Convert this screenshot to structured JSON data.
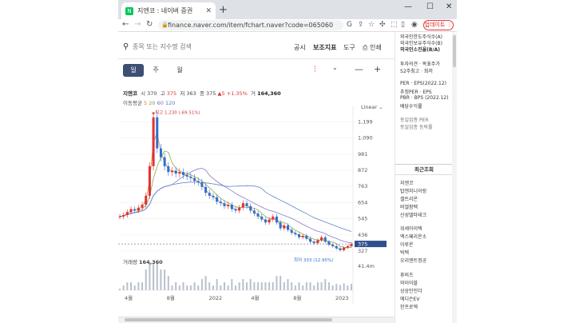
{
  "browser": {
    "tab_title": "지엔코 : 네이버 증권",
    "favicon_letter": "N",
    "url": "finance.naver.com/item/fchart.naver?code=065060",
    "update_label": "업데이트"
  },
  "header": {
    "search_placeholder": "종목 또는 지수명 검색",
    "links": [
      "공시",
      "보조지표",
      "도구",
      "인쇄"
    ]
  },
  "periods": [
    "일",
    "주",
    "월"
  ],
  "active_period": 0,
  "quote": {
    "name": "지엔코",
    "open_label": "시",
    "open": "370",
    "high_label": "고",
    "high": "375",
    "low_label": "저",
    "low": "363",
    "close_label": "종",
    "close": "375",
    "change": "▲5",
    "pct": "+1.35%",
    "vol_label": "거",
    "volume": "164,360"
  },
  "ma": {
    "label": "이동평균",
    "m5": "5",
    "m20": "20",
    "m60": "60",
    "m120": "120"
  },
  "scale_label": "Linear",
  "volume_title": "거래량",
  "volume_value": "164,360",
  "colors": {
    "candle_up": "#e03131",
    "candle_down": "#2f6fd1",
    "ma5": "#e0762c",
    "ma20": "#7aa23a",
    "ma60": "#7e6ac8",
    "ma120": "#4e7bbf",
    "price_tag": "#2f4f8f"
  },
  "chart_data": {
    "type": "line",
    "title": "",
    "y_ticks": [
      1199,
      1090,
      981,
      872,
      763,
      654,
      545,
      436,
      327
    ],
    "ylim": [
      300,
      1250
    ],
    "x_ticks": [
      "4월",
      "8월",
      "2022",
      "4월",
      "8월",
      "2023"
    ],
    "current_price": 375,
    "annotations": {
      "high": "최고 1,230 (-69.51%)",
      "low": "최저 333 (12.95%)"
    },
    "volume_max_label": "41.4m",
    "series": [
      {
        "values": [
          560,
          570,
          590,
          610,
          600,
          620,
          640,
          700,
          900,
          1230,
          1020,
          960,
          900,
          860,
          870,
          850,
          860,
          840,
          830,
          820,
          800,
          790,
          760,
          720,
          700,
          690,
          660,
          650,
          630,
          640,
          610,
          600,
          620,
          650,
          630,
          600,
          580,
          560,
          540,
          520,
          540,
          560,
          520,
          480,
          500,
          470,
          450,
          440,
          420,
          430,
          410,
          390,
          380,
          400,
          420,
          390,
          370,
          360,
          345,
          333,
          350,
          360,
          375
        ]
      }
    ]
  },
  "sidebar": {
    "lines_top": [
      "외국인한도주식수(A)",
      "외국인보유주식수(B)",
      "외국인소진율(B/A)"
    ],
    "lines_mid": [
      "투자의견 · 목표주가",
      "52주최고 · 최저"
    ],
    "lines_per": [
      "PER · EPS(2022.12)",
      "추정PER · EPS",
      "PBR · BPS (2022.12)",
      "배당수익률"
    ],
    "lines_sector": [
      "동일업종 PER",
      "동일업종 등락률"
    ],
    "recent_title": "최근조회",
    "recent1": [
      "지엔코",
      "탑엔지니어링",
      "셀트리온",
      "비엘팜텍",
      "신성델타테크"
    ],
    "recent2": [
      "위세아이텍",
      "엑스페리온소",
      "이루온",
      "빅텍",
      "오리엔트정공"
    ],
    "recent3": [
      "휴비츠",
      "와이어블",
      "상상인인더",
      "에디슨EV",
      "한프로젝"
    ]
  }
}
